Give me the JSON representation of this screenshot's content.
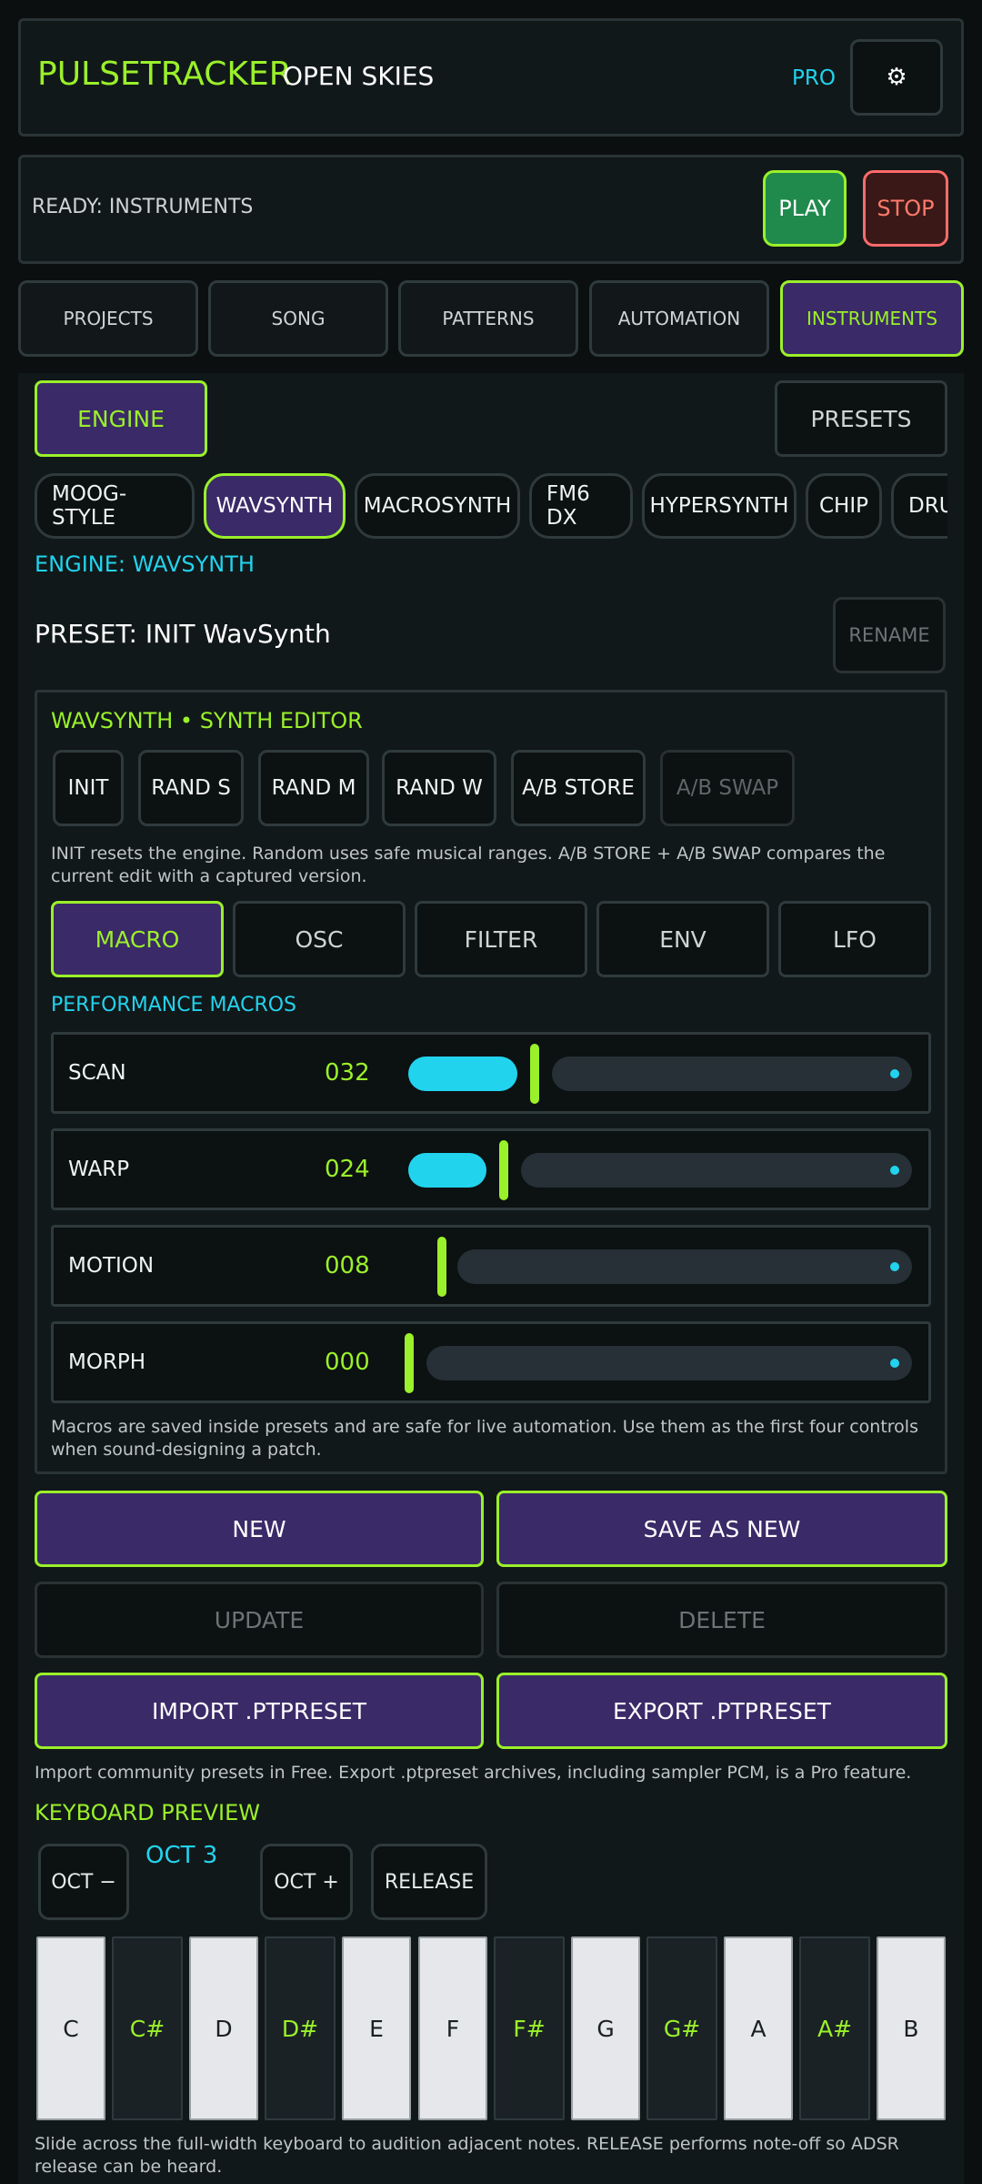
{
  "header": {
    "app_name": "PULSETRACKER",
    "project_name": "OPEN SKIES",
    "pro_label": "PRO",
    "settings_icon": "gear-icon"
  },
  "transport": {
    "status": "READY: INSTRUMENTS",
    "play_label": "PLAY",
    "stop_label": "STOP"
  },
  "tabs": [
    "PROJECTS",
    "SONG",
    "PATTERNS",
    "AUTOMATION",
    "INSTRUMENTS"
  ],
  "instrument": {
    "engine_tab": "ENGINE",
    "presets_tab": "PRESETS",
    "engines": [
      "MOOG-STYLE",
      "WAVSYNTH",
      "MACROSYNTH",
      "FM6 DX",
      "HYPERSYNTH",
      "CHIP",
      "DRU"
    ],
    "engine_label": "ENGINE: WAVSYNTH",
    "preset_label": "PRESET: INIT WavSynth",
    "rename_label": "RENAME"
  },
  "editor": {
    "title": "WAVSYNTH • SYNTH EDITOR",
    "tools": [
      "INIT",
      "RAND S",
      "RAND M",
      "RAND W",
      "A/B STORE",
      "A/B SWAP"
    ],
    "tools_help": "INIT resets the engine. Random uses safe musical ranges. A/B STORE + A/B SWAP compares the current edit with a captured version.",
    "tabs": [
      "MACRO",
      "OSC",
      "FILTER",
      "ENV",
      "LFO"
    ],
    "section_title": "PERFORMANCE MACROS",
    "macros": [
      {
        "label": "SCAN",
        "value": "032"
      },
      {
        "label": "WARP",
        "value": "024"
      },
      {
        "label": "MOTION",
        "value": "008"
      },
      {
        "label": "MORPH",
        "value": "000"
      }
    ],
    "macros_help": "Macros are saved inside presets and are safe for live automation. Use them as the first four controls when sound-designing a patch."
  },
  "preset_actions": {
    "new_label": "NEW",
    "save_as_new_label": "SAVE AS NEW",
    "update_label": "UPDATE",
    "delete_label": "DELETE",
    "import_label": "IMPORT .PTPRESET",
    "export_label": "EXPORT .PTPRESET",
    "help": "Import community presets in Free. Export .ptpreset archives, including sampler PCM, is a Pro feature."
  },
  "keyboard": {
    "title": "KEYBOARD PREVIEW",
    "oct_down_label": "OCT −",
    "octave_label": "OCT 3",
    "oct_up_label": "OCT +",
    "release_label": "RELEASE",
    "keys": [
      "C",
      "C#",
      "D",
      "D#",
      "E",
      "F",
      "F#",
      "G",
      "G#",
      "A",
      "A#",
      "B"
    ],
    "help": "Slide across the full-width keyboard to audition adjacent notes. RELEASE performs note-off so ADSR release can be heard."
  },
  "colors": {
    "accent_green": "#9af02a",
    "accent_cyan": "#22d3ee",
    "active_bg": "#3a2a68",
    "stop_red": "#ff6b6b",
    "play_green": "#1f8a4c"
  }
}
